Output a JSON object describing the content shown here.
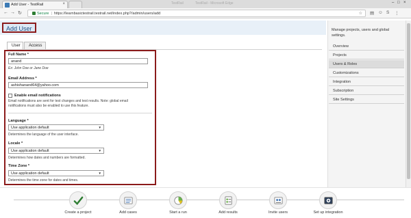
{
  "browser": {
    "active_tab_title": "Add User - TestRail",
    "inactive_tab_title": "TestRail - Microsoft Edge",
    "ghost_title": "TestRail",
    "secure_label": "Secure",
    "url": "https://learnbasictestrail.testrail.net/index.php?/admin/users/add",
    "icons": [
      "back-icon",
      "forward-icon",
      "reload-icon",
      "star-icon",
      "extension-icon",
      "menu-icon"
    ]
  },
  "page": {
    "title": "Add User"
  },
  "tabs": [
    {
      "label": "User"
    },
    {
      "label": "Access"
    }
  ],
  "form": {
    "full_name": {
      "label": "Full Name *",
      "value": "anand",
      "hint": "Ex: John Doe or Jane Doe"
    },
    "email": {
      "label": "Email Address *",
      "value": "ashishanand64@yahoo.com"
    },
    "notifications": {
      "label": "Enable email notifications",
      "checked": false,
      "hint_line1": "Email notifications are sent for test changes and test results. Note: global email",
      "hint_line2": "notifications must also be enabled to use this feature."
    },
    "language": {
      "label": "Language *",
      "value": "Use application default",
      "hint": "Determines the language of the user interface."
    },
    "locale": {
      "label": "Locale *",
      "value": "Use application default",
      "hint": "Determines how dates and numbers are formatted."
    },
    "timezone": {
      "label": "Time Zone *",
      "value": "Use application default",
      "hint": "Determines the time zone for dates and times."
    }
  },
  "sidebar": {
    "description": "Manage projects, users and global settings.",
    "items": [
      {
        "label": "Overview"
      },
      {
        "label": "Projects"
      },
      {
        "label": "Users & Roles"
      },
      {
        "label": "Customizations"
      },
      {
        "label": "Integration"
      },
      {
        "label": "Subscription"
      },
      {
        "label": "Site Settings"
      }
    ],
    "active_item": "Users & Roles"
  },
  "workflow": {
    "steps": [
      {
        "label": "Create a project",
        "icon": "checkmark-icon"
      },
      {
        "label": "Add cases",
        "icon": "test-cases-icon"
      },
      {
        "label": "Start a run",
        "icon": "test-run-icon"
      },
      {
        "label": "Add results",
        "icon": "results-icon"
      },
      {
        "label": "Invite users",
        "icon": "users-icon"
      },
      {
        "label": "Set up integration",
        "icon": "integration-icon"
      }
    ]
  },
  "colors": {
    "highlight_border": "#8b1a1a",
    "page_header_bg": "#e8f0f8",
    "title_text": "#1f4f85",
    "check_green": "#2e7d32"
  }
}
